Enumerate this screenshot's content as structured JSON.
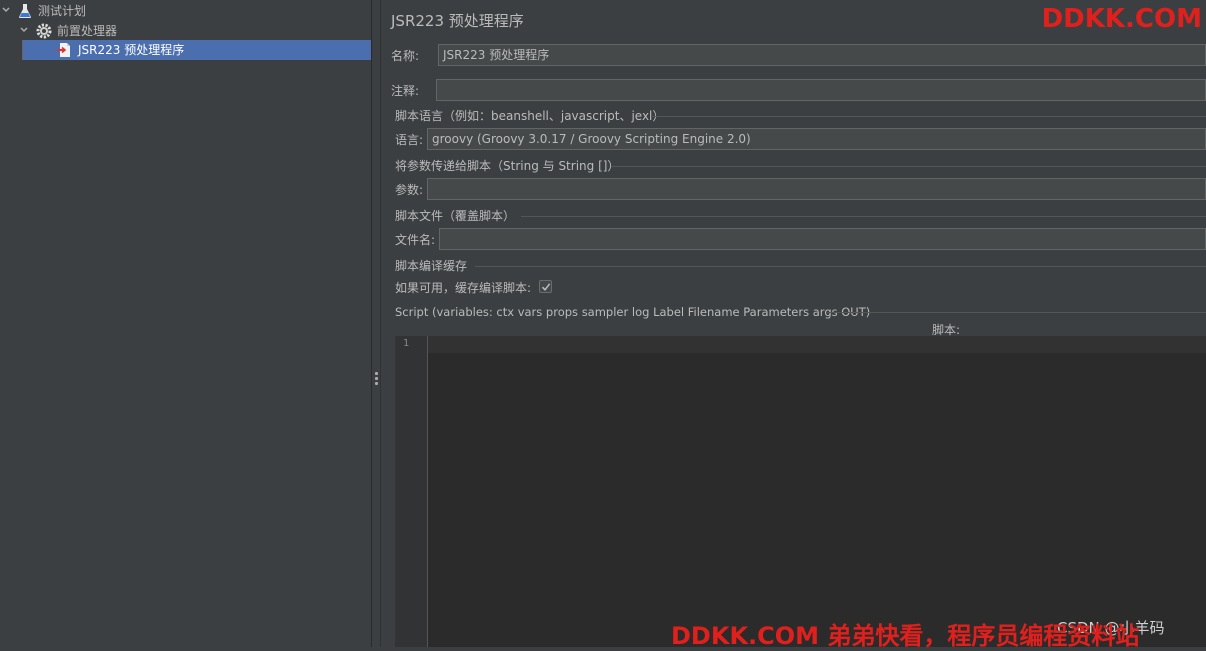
{
  "tree": {
    "items": [
      {
        "label": "测试计划",
        "expanded": true
      },
      {
        "label": "前置处理器",
        "expanded": true
      },
      {
        "label": "JSR223 预处理程序",
        "selected": true
      }
    ]
  },
  "panel": {
    "title": "JSR223 预处理程序",
    "name_label": "名称:",
    "name_value": "JSR223 预处理程序",
    "comment_label": "注释:",
    "comment_value": "",
    "script_lang_section": "脚本语言（例如：beanshell、javascript、jexl）",
    "lang_label": "语言:",
    "lang_value": "groovy     (Groovy 3.0.17 / Groovy Scripting Engine 2.0)",
    "params_section": "将参数传递给脚本（String 与 String []）",
    "params_label": "参数:",
    "params_value": "",
    "script_file_section": "脚本文件（覆盖脚本）",
    "filename_label": "文件名:",
    "filename_value": "",
    "cache_section": "脚本编译缓存",
    "cache_label": "如果可用，缓存编译脚本:",
    "cache_checked": true,
    "script_section": "Script (variables: ctx vars props sampler log Label Filename Parameters args OUT)",
    "script_label": "脚本:",
    "line_number": "1"
  },
  "watermarks": {
    "top": "DDKK.COM",
    "bottom": "DDKK.COM 弟弟快看，程序员编程资料站",
    "csdn": "CSDN @小羊码"
  },
  "colors": {
    "background": "#3c3f41",
    "selection": "#4b6eaf",
    "editor": "#2b2b2b",
    "watermark": "#e0201c"
  }
}
